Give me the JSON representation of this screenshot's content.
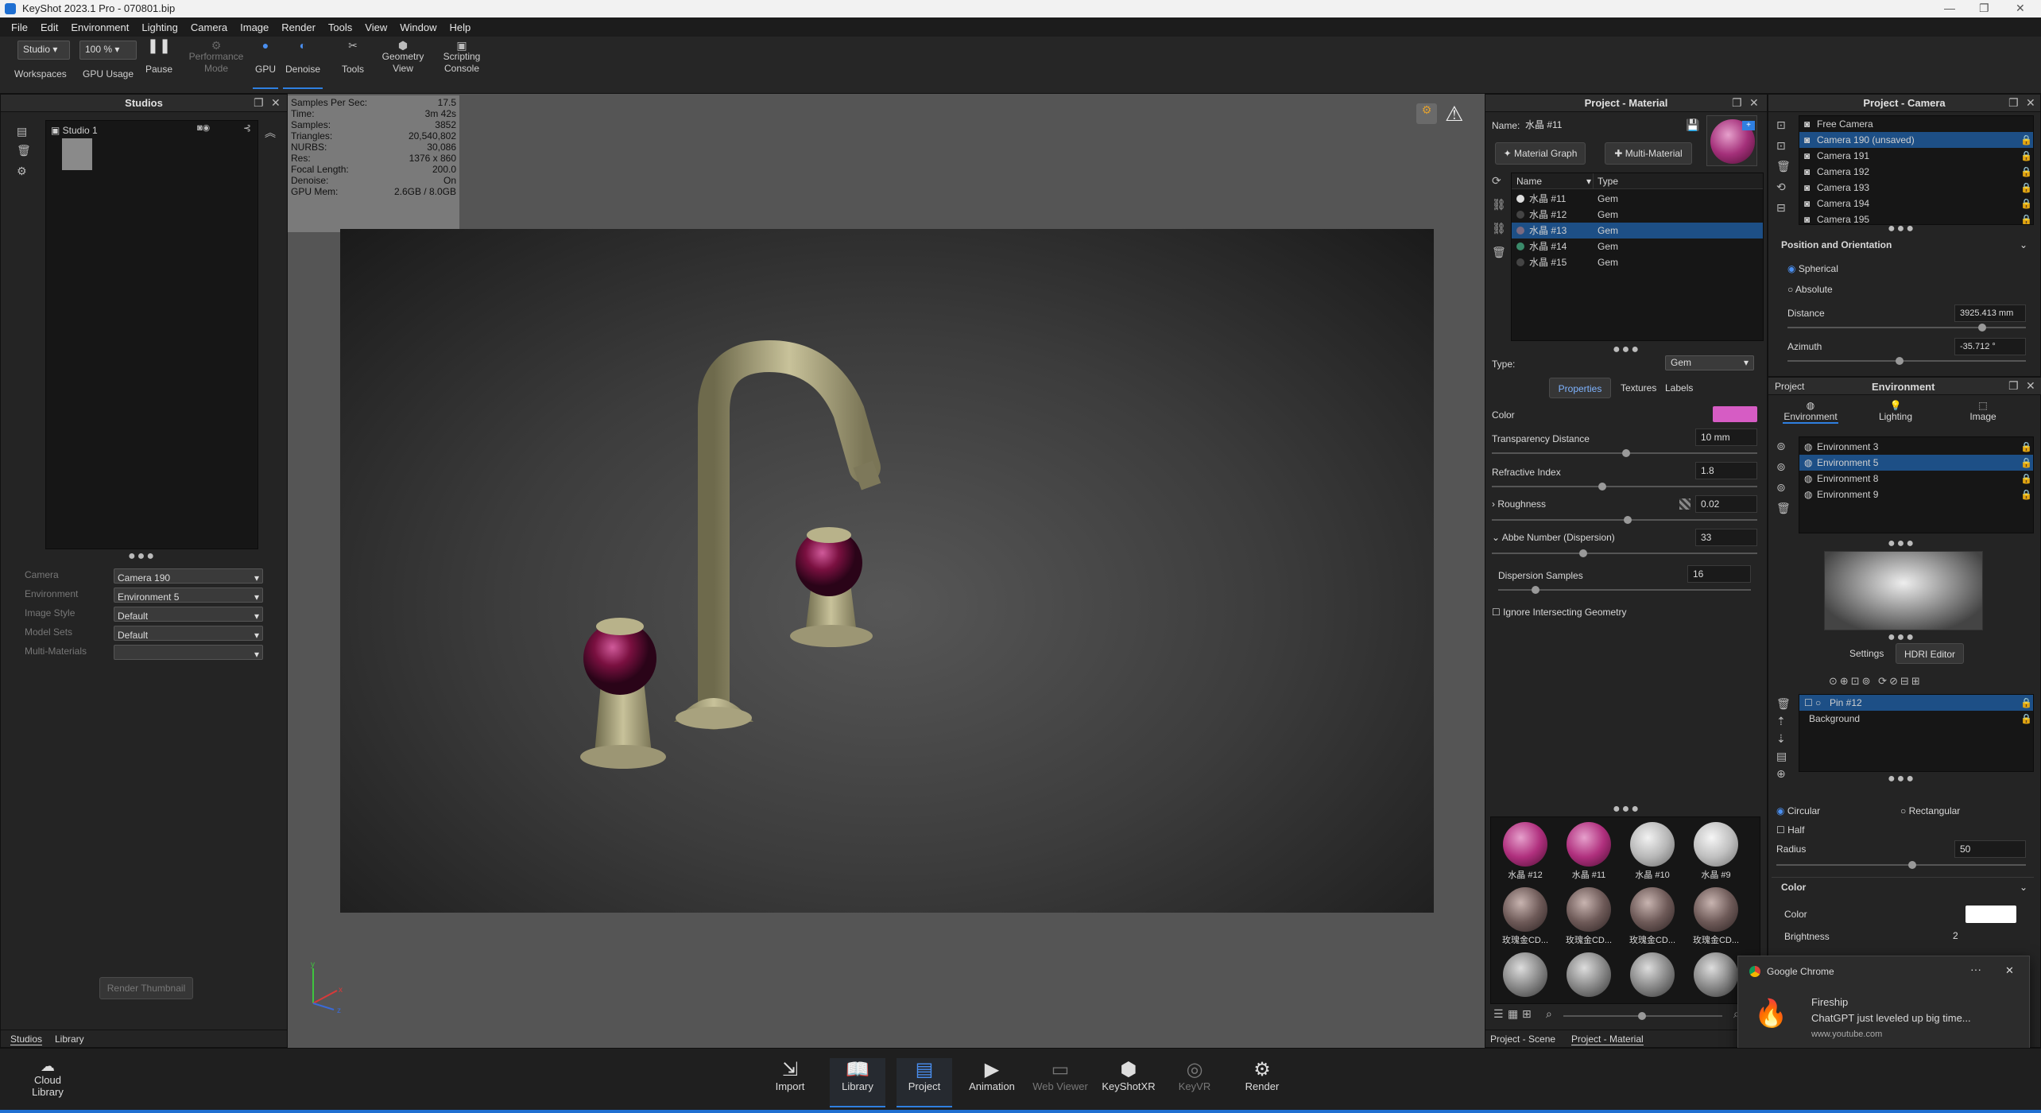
{
  "title_bar": {
    "title": "KeyShot 2023.1 Pro  - 070801.bip"
  },
  "menu": [
    "File",
    "Edit",
    "Environment",
    "Lighting",
    "Camera",
    "Image",
    "Render",
    "Tools",
    "View",
    "Window",
    "Help"
  ],
  "toolbar": {
    "workspace_value": "Studio",
    "zoom_value": "100 %",
    "workspaces": "Workspaces",
    "gpu_usage": "GPU Usage",
    "pause": "Pause",
    "perf1": "Performance",
    "perf2": "Mode",
    "gpu": "GPU",
    "denoise": "Denoise",
    "tools": "Tools",
    "geo1": "Geometry",
    "geo2": "View",
    "scr1": "Scripting",
    "scr2": "Console"
  },
  "studios": {
    "title": "Studios",
    "item": "Studio 1",
    "props": [
      {
        "label": "Camera",
        "value": "Camera 190"
      },
      {
        "label": "Environment",
        "value": "Environment 5"
      },
      {
        "label": "Image Style",
        "value": "Default"
      },
      {
        "label": "Model Sets",
        "value": "Default"
      },
      {
        "label": "Multi-Materials",
        "value": ""
      }
    ],
    "render_thumbnail": "Render Thumbnail",
    "tabs": [
      "Studios",
      "Library"
    ]
  },
  "stats": [
    {
      "k": "Samples Per Sec:",
      "v": "17.5"
    },
    {
      "k": "Time:",
      "v": "3m 42s"
    },
    {
      "k": "Samples:",
      "v": "3852"
    },
    {
      "k": "Triangles:",
      "v": "20,540,802"
    },
    {
      "k": "NURBS:",
      "v": "30,086"
    },
    {
      "k": "Res:",
      "v": "1376 x 860"
    },
    {
      "k": "Focal Length:",
      "v": "200.0"
    },
    {
      "k": "Denoise:",
      "v": "On"
    },
    {
      "k": "GPU Mem:",
      "v": "2.6GB / 8.0GB"
    }
  ],
  "material": {
    "title": "Project - Material",
    "name_label": "Name:",
    "name_value": "水晶 #11",
    "material_graph": "Material Graph",
    "multi_material": "Multi-Material",
    "col_name": "Name",
    "col_type": "Type",
    "list": [
      {
        "name": "水晶 #11",
        "type": "Gem"
      },
      {
        "name": "水晶 #12",
        "type": "Gem"
      },
      {
        "name": "水晶 #13",
        "type": "Gem"
      },
      {
        "name": "水晶 #14",
        "type": "Gem"
      },
      {
        "name": "水晶 #15",
        "type": "Gem"
      }
    ],
    "type_label": "Type:",
    "type_value": "Gem",
    "tabs": [
      "Properties",
      "Textures",
      "Labels"
    ],
    "color_label": "Color",
    "color_value": "#d65cc4",
    "transparency_label": "Transparency Distance",
    "transparency_value": "10 mm",
    "refractive_label": "Refractive Index",
    "refractive_value": "1.8",
    "roughness_label": "Roughness",
    "roughness_value": "0.02",
    "abbe_label": "Abbe Number (Dispersion)",
    "abbe_value": "33",
    "dispersion_label": "Dispersion Samples",
    "dispersion_value": "16",
    "ignore_label": "Ignore Intersecting Geometry",
    "library": [
      {
        "label": "水晶 #12",
        "color": "#b0307e"
      },
      {
        "label": "水晶 #11",
        "color": "#b0307e"
      },
      {
        "label": "水晶 #10",
        "color": "#b8b8b8"
      },
      {
        "label": "水晶 #9",
        "color": "#c0c0c0"
      },
      {
        "label": "玫瑰金CD...",
        "color": "#6e5a58"
      },
      {
        "label": "玫瑰金CD...",
        "color": "#6e5a58"
      },
      {
        "label": "玫瑰金CD...",
        "color": "#6e5a58"
      },
      {
        "label": "玫瑰金CD...",
        "color": "#6e5a58"
      }
    ],
    "bottom_tabs": [
      "Project - Scene",
      "Project - Material"
    ]
  },
  "camera": {
    "title": "Project - Camera",
    "list": [
      "Free Camera",
      "Camera 190 (unsaved)",
      "Camera 191",
      "Camera 192",
      "Camera 193",
      "Camera 194",
      "Camera 195"
    ],
    "section": "Position and Orientation",
    "spherical": "Spherical",
    "absolute": "Absolute",
    "distance_label": "Distance",
    "distance_value": "3925.413 mm",
    "azimuth_label": "Azimuth",
    "azimuth_value": "-35.712 °"
  },
  "environment": {
    "project_label": "Project",
    "title": "Environment",
    "tabs": [
      "Environment",
      "Lighting",
      "Image"
    ],
    "list": [
      "Environment 3",
      "Environment 5",
      "Environment 8",
      "Environment 9"
    ],
    "settings": "Settings",
    "hdri_editor": "HDRI Editor",
    "pins": [
      "Pin #12",
      "Background"
    ],
    "circular": "Circular",
    "rectangular": "Rectangular",
    "half": "Half",
    "radius_label": "Radius",
    "radius_value": "50",
    "color_section": "Color",
    "color_label": "Color",
    "brightness_label": "Brightness",
    "brightness_value": "2"
  },
  "notification": {
    "app": "Google Chrome",
    "title": "Fireship",
    "body": "ChatGPT just leveled up big time...",
    "url": "www.youtube.com",
    "close_button": "关闭"
  },
  "bottom_bar": {
    "cloud1": "Cloud",
    "cloud2": "Library",
    "items": [
      "Import",
      "Library",
      "Project",
      "Animation",
      "Web Viewer",
      "KeyShotXR",
      "KeyVR",
      "Render"
    ]
  }
}
